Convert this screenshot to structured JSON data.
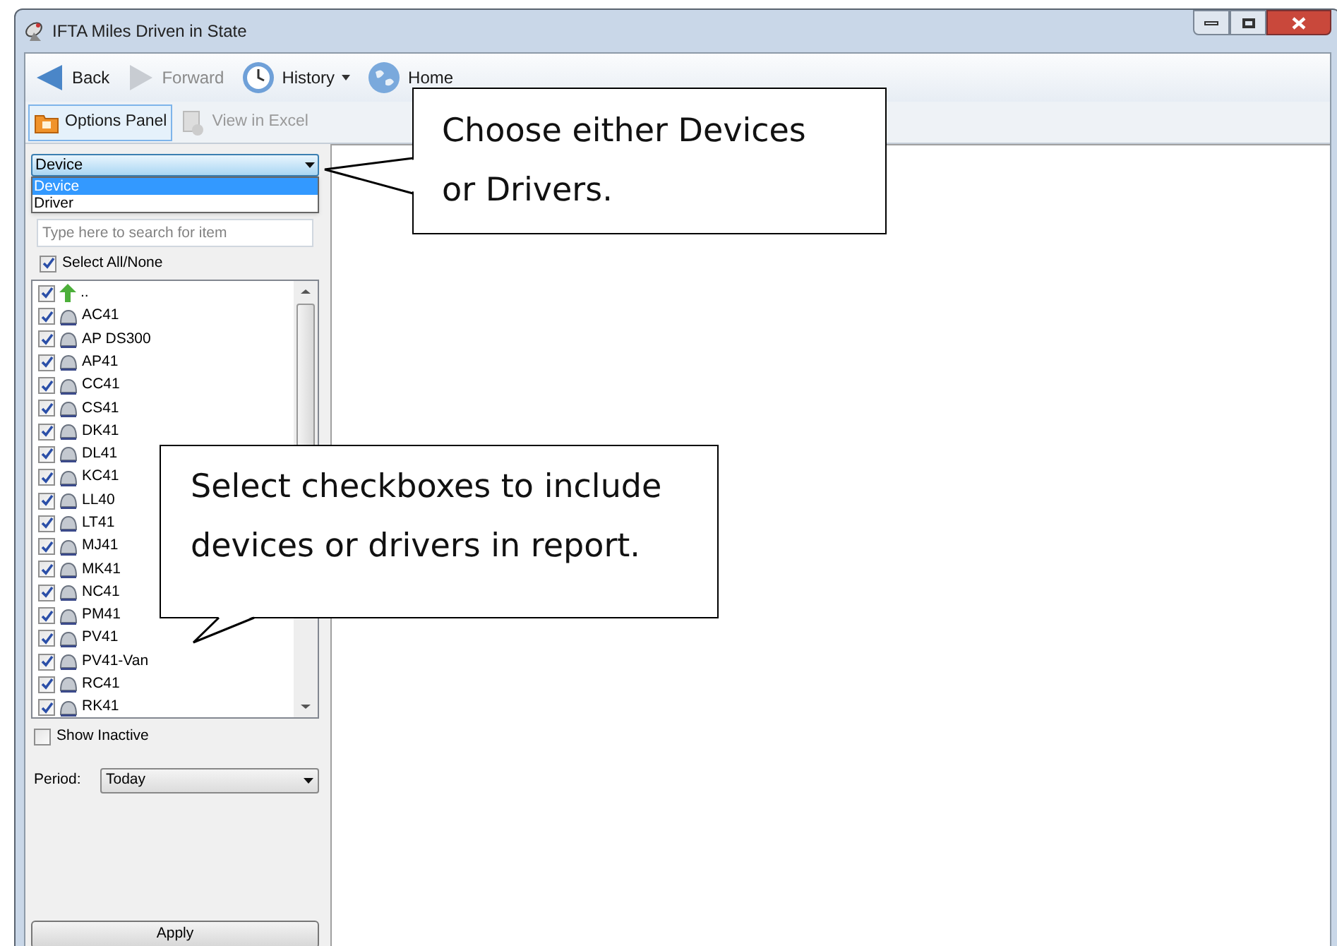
{
  "window": {
    "title": "IFTA Miles Driven in State"
  },
  "nav_toolbar": [
    {
      "kind": "back",
      "label": "Back",
      "disabled": false
    },
    {
      "kind": "forward",
      "label": "Forward",
      "disabled": true
    },
    {
      "kind": "history",
      "label": "History",
      "disabled": false
    },
    {
      "kind": "home",
      "label": "Home",
      "disabled": false
    }
  ],
  "action_toolbar": [
    {
      "kind": "options",
      "label": "Options Panel",
      "selected": true,
      "disabled": false
    },
    {
      "kind": "excel",
      "label": "View in Excel",
      "selected": false,
      "disabled": true
    }
  ],
  "type_dropdown": {
    "value": "Device",
    "expanded": true,
    "options": [
      {
        "label": "Device",
        "selected": true
      },
      {
        "label": "Driver",
        "selected": false
      }
    ]
  },
  "search": {
    "placeholder": "Type here to search for item"
  },
  "select_all": {
    "label": "Select All/None",
    "checked": true
  },
  "items": [
    {
      "kind": "parent",
      "label": "..",
      "checked": true
    },
    {
      "kind": "device",
      "label": "AC41",
      "checked": true
    },
    {
      "kind": "device",
      "label": "AP DS300",
      "checked": true
    },
    {
      "kind": "device",
      "label": "AP41",
      "checked": true
    },
    {
      "kind": "device",
      "label": "CC41",
      "checked": true
    },
    {
      "kind": "device",
      "label": "CS41",
      "checked": true
    },
    {
      "kind": "device",
      "label": "DK41",
      "checked": true
    },
    {
      "kind": "device",
      "label": "DL41",
      "checked": true
    },
    {
      "kind": "device",
      "label": "KC41",
      "checked": true
    },
    {
      "kind": "device",
      "label": "LL40",
      "checked": true
    },
    {
      "kind": "device",
      "label": "LT41",
      "checked": true
    },
    {
      "kind": "device",
      "label": "MJ41",
      "checked": true
    },
    {
      "kind": "device",
      "label": "MK41",
      "checked": true
    },
    {
      "kind": "device",
      "label": "NC41",
      "checked": true
    },
    {
      "kind": "device",
      "label": "PM41",
      "checked": true
    },
    {
      "kind": "device",
      "label": "PV41",
      "checked": true
    },
    {
      "kind": "device",
      "label": "PV41-Van",
      "checked": true
    },
    {
      "kind": "device",
      "label": "RC41",
      "checked": true
    },
    {
      "kind": "device",
      "label": "RK41",
      "checked": true
    }
  ],
  "show_inactive": {
    "label": "Show Inactive",
    "checked": false
  },
  "period": {
    "label": "Period:",
    "value": "Today"
  },
  "apply_button": "Apply",
  "callouts": [
    {
      "text": "Choose either Devices or Drivers."
    },
    {
      "text": "Select checkboxes to include devices or drivers in report."
    }
  ]
}
